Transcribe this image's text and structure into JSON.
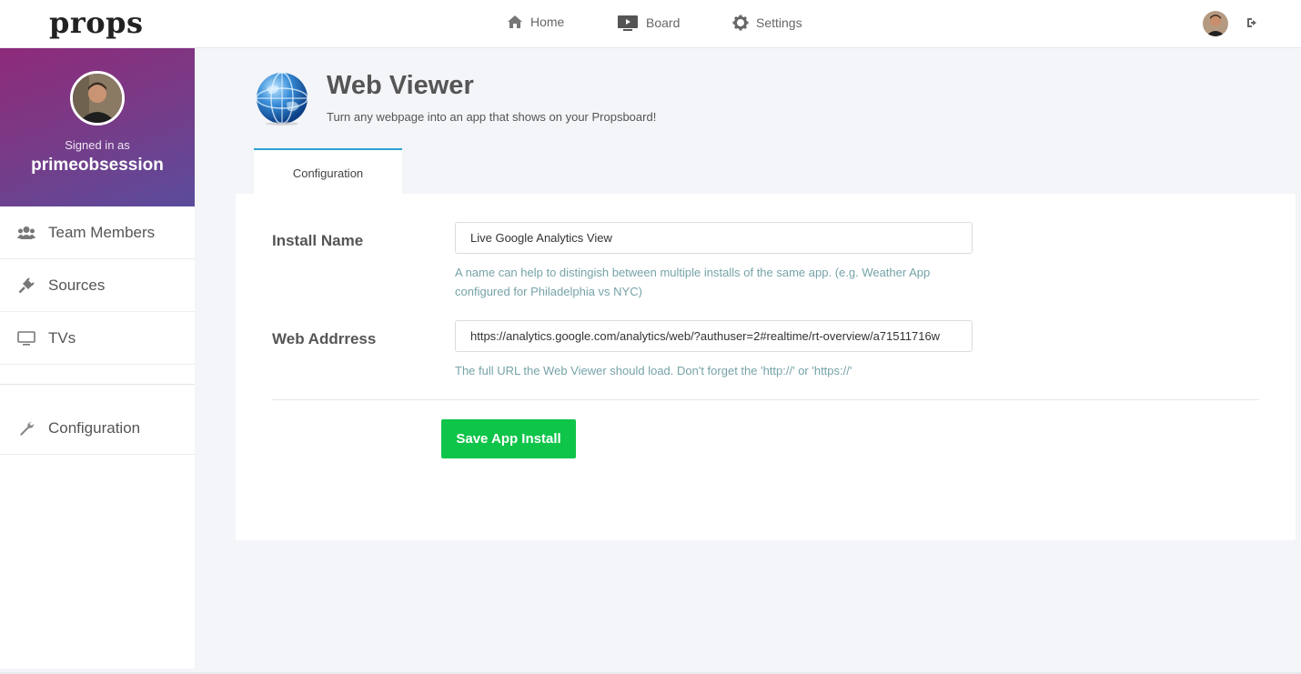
{
  "topbar": {
    "logo": "props",
    "nav": [
      {
        "label": "Home",
        "icon": "home-icon"
      },
      {
        "label": "Board",
        "icon": "board-icon"
      },
      {
        "label": "Settings",
        "icon": "gear-icon"
      }
    ]
  },
  "sidebar": {
    "signed_in_label": "Signed in as",
    "username": "primeobsession",
    "items": [
      {
        "label": "Team Members",
        "icon": "users-icon"
      },
      {
        "label": "Sources",
        "icon": "plug-icon"
      },
      {
        "label": "TVs",
        "icon": "monitor-icon"
      },
      {
        "label": "Configuration",
        "icon": "wrench-icon"
      }
    ]
  },
  "app": {
    "title": "Web Viewer",
    "subtitle": "Turn any webpage into an app that shows on your Propsboard!",
    "icon": "globe-icon"
  },
  "tabs": [
    {
      "label": "Configuration",
      "active": true
    }
  ],
  "form": {
    "install_name": {
      "label": "Install Name",
      "value": "Live Google Analytics View",
      "help": "A name can help to distingish between multiple installs of the same app. (e.g. Weather App configured for Philadelphia vs NYC)"
    },
    "web_address": {
      "label": "Web Addrress",
      "value": "https://analytics.google.com/analytics/web/?authuser=2#realtime/rt-overview/a71511716w",
      "help": "The full URL the Web Viewer should load. Don't forget the 'http://' or 'https://'"
    },
    "save_label": "Save App Install"
  },
  "colors": {
    "accent_tab": "#2ba3d4",
    "save_button": "#0ec449",
    "help_text": "#76a3a8",
    "profile_gradient_start": "#8e2a7a",
    "profile_gradient_end": "#5a4c9c"
  }
}
